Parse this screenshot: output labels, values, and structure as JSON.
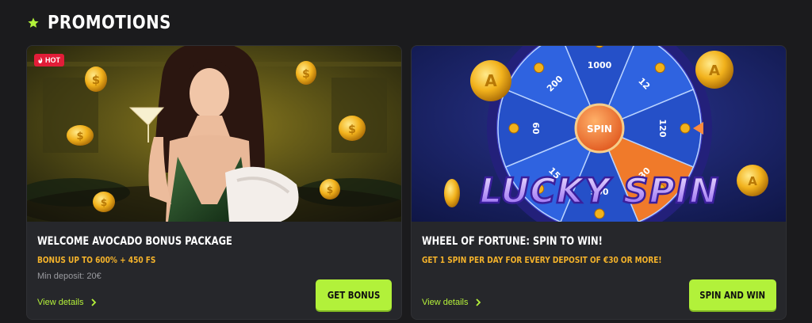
{
  "section": {
    "title": "PROMOTIONS",
    "icon": "star-icon"
  },
  "colors": {
    "accent": "#b2f13a",
    "highlight": "#f5b32b",
    "hot": "#e21d38",
    "card_bg": "#26272b"
  },
  "promotions": [
    {
      "badge": "HOT",
      "title": "WELCOME AVOCADO BONUS PACKAGE",
      "subtitle": "BONUS UP TO 600% + 450 FS",
      "min_deposit": "Min deposit: 20€",
      "details_label": "View details",
      "cta_label": "GET BONUS"
    },
    {
      "title": "WHEEL OF FORTUNE: SPIN TO WIN!",
      "subtitle": "GET 1 SPIN PER DAY FOR EVERY DEPOSIT OF €30 OR MORE!",
      "details_label": "View details",
      "cta_label": "SPIN AND WIN",
      "banner_text": "LUCKY SPIN",
      "wheel": {
        "center": "SPIN",
        "values": [
          "1000",
          "12",
          "120",
          "30",
          "500",
          "15",
          "60",
          "200"
        ]
      }
    }
  ]
}
